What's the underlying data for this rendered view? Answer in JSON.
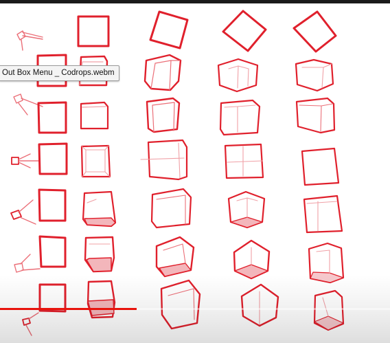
{
  "video": {
    "filename_tooltip": "Out Box Menu _ Codrops.webm",
    "progress_fraction": 0.35
  },
  "colors": {
    "sketch_red": "#e0202c",
    "light_red": "#eb6f78",
    "faint_red": "#f0a0a6",
    "shade_pink": "#f3b6bb",
    "progress_red": "#e8130c",
    "top_bar": "#1a1a1a"
  }
}
